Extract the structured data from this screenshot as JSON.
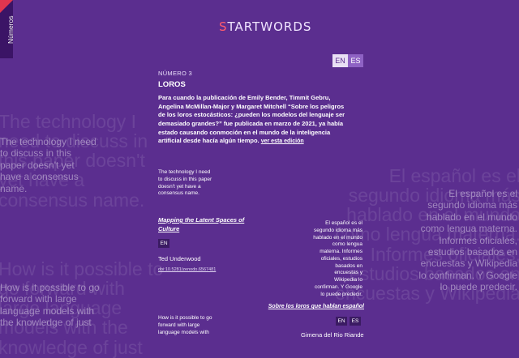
{
  "sidebar": {
    "tab_label": "Números"
  },
  "logo": {
    "first_letter": "S",
    "rest": "TARTWORDS"
  },
  "lang_switch": {
    "en": "EN",
    "es": "ES"
  },
  "issue": {
    "number_label": "NÚMERO 3",
    "title": "LOROS",
    "intro": "Para cuando la publicación de Emily Bender, Timmit Gebru, Angelina McMillan-Major y Margaret Mitchell “Sobre los peligros de los loros estocásticos: ¿pueden los modelos del lenguaje ser demasiado grandes?” fue publicada en marzo de 2021, ya había estado causando conmoción en el mundo de la inteligencia artificial desde hacía algún tiempo.",
    "see_edition_link": "ver esta edición"
  },
  "articles": [
    {
      "excerpt": "The technology I need to discuss in this paper doesn't yet have a consensus name.",
      "title": "Mapping the Latent Spaces of Culture",
      "langs": [
        "EN"
      ],
      "author": "Ted Underwood",
      "doi": "doi:10.5281/zenodo.6567481"
    },
    {
      "excerpt": "El español es el segundo idioma más hablado en el mundo como lengua materna. Informes oficiales, estudios basados en encuestas y Wikipedia lo confirman. Y Google lo puede predecir.",
      "title": "Sobre los loros que hablan español",
      "langs": [
        "EN",
        "ES"
      ],
      "author": "Gimena del Rio Riande"
    },
    {
      "excerpt": "How is it possible to go forward with large language models with"
    }
  ],
  "background": {
    "left_top_big": "The technology I need to discuss in this paper doesn't yet have a consensus name.",
    "left_top_echo": "The technology I need to discuss in this paper doesn't yet have a consensus name.",
    "left_bottom_big": "How is it possible to go forward with large language models with the knowledge of just",
    "left_bottom_echo": "How is it possible to go forward with large language models with the knowledge of just",
    "right_big": "El español es el segundo idioma más hablado en el mundo como lengua materna. Informes oficiales, estudios basados en encuestas y Wikipedia",
    "right_echo": "El español es el segundo idioma más hablado en el mundo como lengua materna. Informes oficiales, estudios basados en encuestas y Wikipedia lo confirman. Y Google lo puede predecir."
  }
}
